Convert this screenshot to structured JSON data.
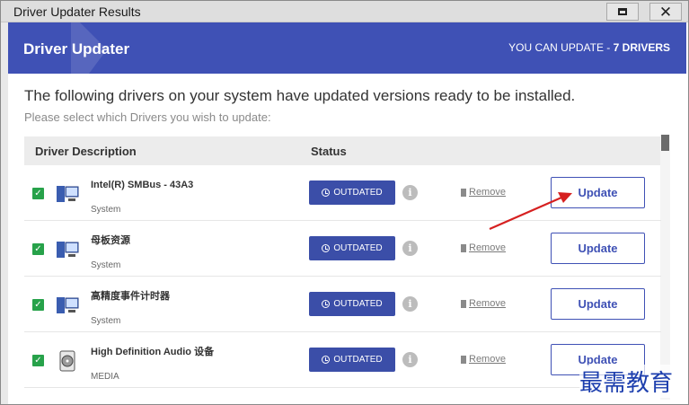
{
  "window": {
    "title": "Driver Updater Results",
    "max_icon": "maximize-icon",
    "close_icon": "close-icon",
    "close_glyph": "✕"
  },
  "banner": {
    "brand": "Driver Updater",
    "update_prefix": "YOU CAN UPDATE - ",
    "update_count": "7 DRIVERS",
    "color": "#3f51b5"
  },
  "intro": {
    "heading": "The following drivers on your system have updated versions ready to be installed.",
    "subheading": "Please select which Drivers you wish to update:"
  },
  "table": {
    "col_description": "Driver Description",
    "col_status": "Status",
    "rows": [
      {
        "name": "Intel(R) SMBus - 43A3",
        "category": "System",
        "icon": "system-device-icon",
        "status": "OUTDATED",
        "remove": "Remove",
        "update": "Update",
        "checked": true
      },
      {
        "name": "母板资源",
        "category": "System",
        "icon": "system-device-icon",
        "status": "OUTDATED",
        "remove": "Remove",
        "update": "Update",
        "checked": true
      },
      {
        "name": "高精度事件计时器",
        "category": "System",
        "icon": "system-device-icon",
        "status": "OUTDATED",
        "remove": "Remove",
        "update": "Update",
        "checked": true
      },
      {
        "name": "High Definition Audio 设备",
        "category": "MEDIA",
        "icon": "media-device-icon",
        "status": "OUTDATED",
        "remove": "Remove",
        "update": "Update",
        "checked": true
      }
    ]
  },
  "colors": {
    "accent": "#3f51b5",
    "status_button": "#3b4ea8",
    "checkbox": "#27a24a",
    "arrow": "#d62020"
  },
  "watermark": "最需教育"
}
